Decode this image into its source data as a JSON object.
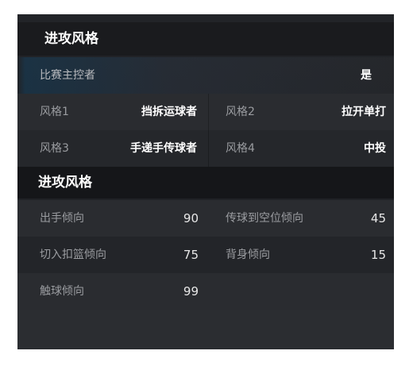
{
  "section1": {
    "title": "进攻风格",
    "controller": {
      "label": "比赛主控者",
      "value": "是"
    },
    "styles": [
      {
        "label": "风格1",
        "value": "挡拆运球者"
      },
      {
        "label": "风格2",
        "value": "拉开单打"
      },
      {
        "label": "风格3",
        "value": "手递手传球者"
      },
      {
        "label": "风格4",
        "value": "中投"
      }
    ]
  },
  "section2": {
    "title": "进攻风格",
    "tendencies": [
      {
        "label": "出手倾向",
        "value": "90"
      },
      {
        "label": "传球到空位倾向",
        "value": "45"
      },
      {
        "label": "切入扣篮倾向",
        "value": "75"
      },
      {
        "label": "背身倾向",
        "value": "15"
      },
      {
        "label": "触球倾向",
        "value": "99"
      }
    ]
  },
  "colors": {
    "panel_bg": "#1f2125",
    "header_bg": "#1a1b1e",
    "accent_blue": "#0078c8"
  }
}
